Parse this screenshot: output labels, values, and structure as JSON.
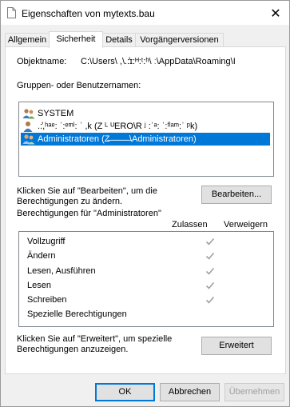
{
  "window": {
    "title": "Eigenschaften von mytexts.bau",
    "close_symbol": "✕"
  },
  "tabs": [
    {
      "label": "Allgemein",
      "active": false
    },
    {
      "label": "Sicherheit",
      "active": true
    },
    {
      "label": "Details",
      "active": false
    },
    {
      "label": "Vorgängerversionen",
      "active": false
    }
  ],
  "object": {
    "label": "Objektname:",
    "value": "C:\\Users\\ ,\\.:̓ɪ:ᴴ:ᵗ:ʰ\\ ː\\AppData\\Roaming\\I"
  },
  "groups_label": "Gruppen- oder Benutzernamen:",
  "users": [
    {
      "name": "SYSTEM",
      "icon": "users-group-icon",
      "selected": false
    },
    {
      "name": "  .:̓,ʰᵃᵉ: ˈ:ᵉᵐˡ: ˈ ,k (Z  ᴸ  ᵁERO\\R  ʲ :ˈᵃ: ˈ:ᶠˡᵃᵐ:ˈ ᵖk)",
      "icon": "user-icon",
      "selected": false
    },
    {
      "name": "Administratoren (Z̶ ̶ ̶ ̶ ̶ ̶ ̶ ̶ ̶\\Administratoren)",
      "icon": "users-group-icon",
      "selected": true
    }
  ],
  "edit_hint": "Klicken Sie auf \"Bearbeiten\", um die Berechtigungen zu ändern.",
  "edit_button": "Bearbeiten...",
  "permissions_for": "Berechtigungen für \"Administratoren\"",
  "columns": {
    "allow": "Zulassen",
    "deny": "Verweigern"
  },
  "permissions": [
    {
      "name": "Vollzugriff",
      "allow": true,
      "deny": false
    },
    {
      "name": "Ändern",
      "allow": true,
      "deny": false
    },
    {
      "name": "Lesen, Ausführen",
      "allow": true,
      "deny": false
    },
    {
      "name": "Lesen",
      "allow": true,
      "deny": false
    },
    {
      "name": "Schreiben",
      "allow": true,
      "deny": false
    },
    {
      "name": "Spezielle Berechtigungen",
      "allow": false,
      "deny": false
    }
  ],
  "advanced_hint": "Klicken Sie auf \"Erweitert\", um spezielle Berechtigungen anzuzeigen.",
  "advanced_button": "Erweitert",
  "footer": {
    "ok": "OK",
    "cancel": "Abbrechen",
    "apply": "Übernehmen"
  },
  "colors": {
    "selection": "#0078d7",
    "check_disabled": "#a0a0a0"
  }
}
